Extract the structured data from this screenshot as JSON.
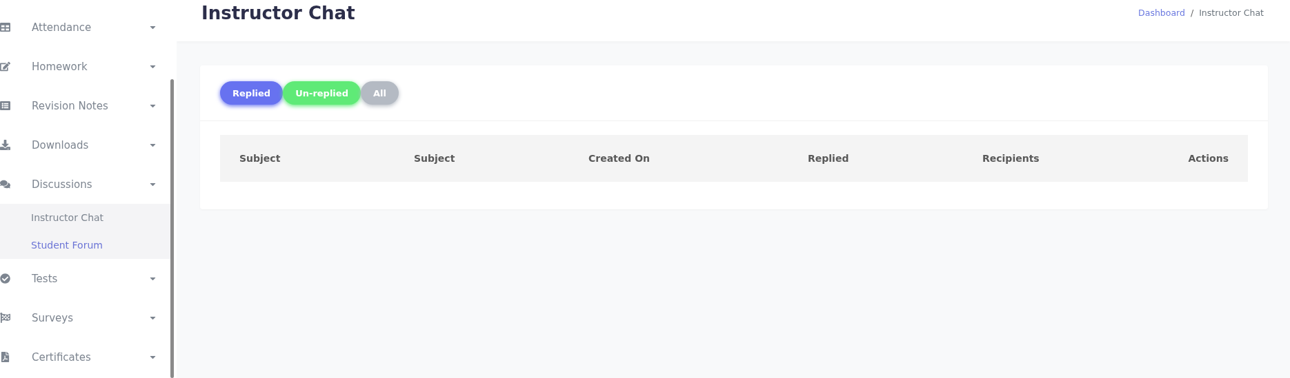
{
  "sidebar": {
    "items": [
      {
        "label": "Attendance"
      },
      {
        "label": "Homework"
      },
      {
        "label": "Revision Notes"
      },
      {
        "label": "Downloads"
      },
      {
        "label": "Discussions",
        "children": [
          {
            "label": "Instructor Chat",
            "selected": false
          },
          {
            "label": "Student Forum",
            "selected": true
          }
        ]
      },
      {
        "label": "Tests"
      },
      {
        "label": "Surveys"
      },
      {
        "label": "Certificates"
      }
    ]
  },
  "header": {
    "title": "Instructor Chat",
    "breadcrumb": [
      {
        "label": "Dashboard",
        "kind": "link"
      },
      {
        "label": "/",
        "kind": "separator"
      },
      {
        "label": "Instructor Chat",
        "kind": "current"
      }
    ]
  },
  "filters": [
    {
      "label": "Replied",
      "color": "#6772f0"
    },
    {
      "label": "Un-replied",
      "color": "#5fea77"
    },
    {
      "label": "All",
      "color": "#b4bac3"
    }
  ],
  "table": {
    "columns": [
      "Subject",
      "Subject",
      "Created On",
      "Replied",
      "Recipients",
      "Actions"
    ]
  }
}
